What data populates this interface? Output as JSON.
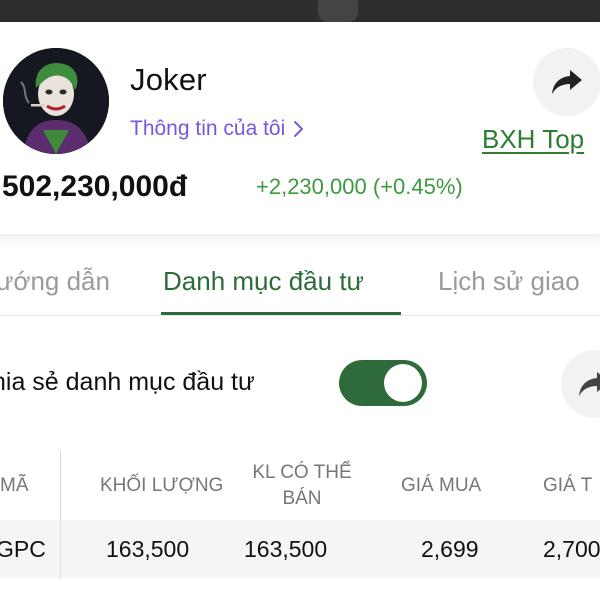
{
  "profile": {
    "name": "Joker",
    "my_info_label": "Thông tin của tôi",
    "leaderboard_label": "BXH Top",
    "balance": "502,230,000đ",
    "change": "+2,230,000 (+0.45%)"
  },
  "tabs": [
    {
      "label": "ướng dẫn"
    },
    {
      "label": "Danh mục đầu tư"
    },
    {
      "label": "Lịch sử giao"
    }
  ],
  "share_portfolio": {
    "label": "hia sẻ danh mục đầu tư",
    "enabled": true
  },
  "table": {
    "headers": {
      "code": "MÃ",
      "volume": "KHỐI LƯỢNG",
      "sellable_line1": "KL CÓ THỂ",
      "sellable_line2": "BÁN",
      "buy_price": "GIÁ MUA",
      "current_price": "GIÁ T"
    },
    "rows": [
      {
        "code": "GPC",
        "volume": "163,500",
        "sellable": "163,500",
        "buy_price": "2,699",
        "current_price": "2,700"
      }
    ]
  },
  "colors": {
    "accent_green": "#2e6b39",
    "gain_green": "#3d9a3f",
    "link_purple": "#7a56e0"
  },
  "icons": {
    "share": "share-arrow-icon",
    "chevron": "chevron-right-icon"
  }
}
